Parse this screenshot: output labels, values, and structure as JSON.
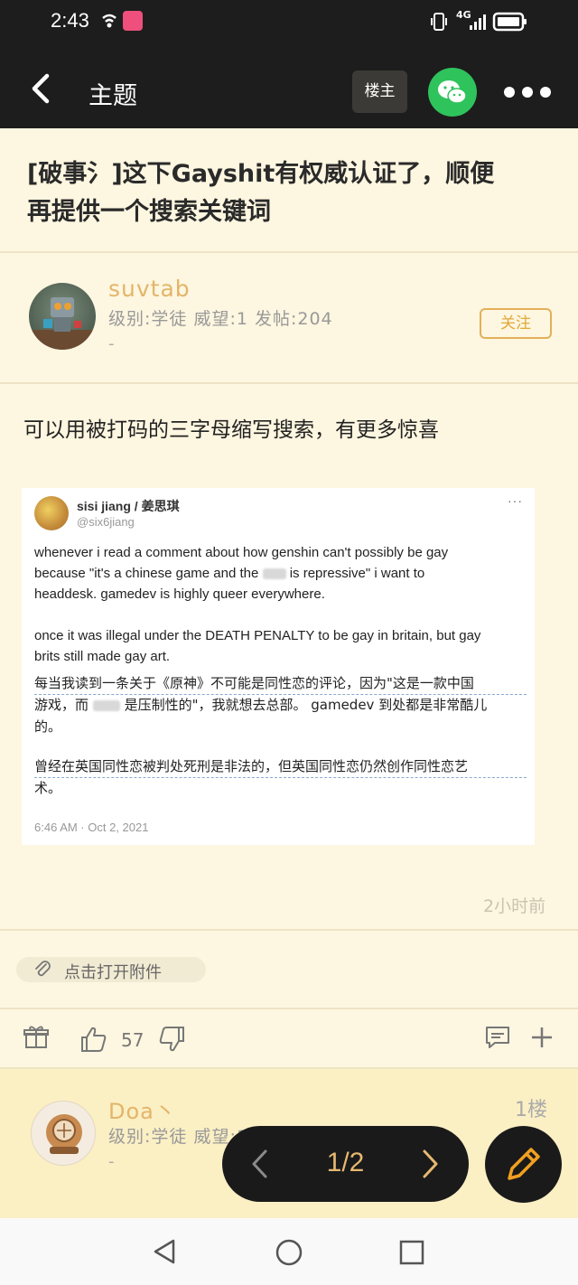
{
  "status_bar": {
    "time": "2:43",
    "network_badge": "4G"
  },
  "app_bar": {
    "title": "主题",
    "op_label": "楼主"
  },
  "post": {
    "title_line1": "[破事氵]这下Gayshit有权威认证了，顺便",
    "title_line2": "再提供一个搜索关键词",
    "author": {
      "name": "suvtab",
      "info": "级别:学徒 威望:1 发帖:204",
      "signature": "-"
    },
    "follow_label": "关注",
    "body": "可以用被打码的三字母缩写搜索，有更多惊喜",
    "time_ago": "2小时前",
    "attachment_label": "点击打开附件",
    "like_count": "57"
  },
  "tweet": {
    "name": "sisi jiang / 姜思琪",
    "handle": "@six6jiang",
    "more": "···",
    "en_line1": "whenever i read a comment about how genshin can't possibly be gay",
    "en_line2a": "because \"it's a chinese game and the",
    "en_line2b": "is repressive\" i want to",
    "en_line3": "headdesk. gamedev is highly queer everywhere.",
    "en_line4": "once it was illegal under the DEATH PENALTY to be gay in britain, but gay",
    "en_line5": "brits still made gay art.",
    "cn_line1": "每当我读到一条关于《原神》不可能是同性恋的评论，因为\"这是一款中国",
    "cn_line2a": "游戏，而",
    "cn_line2b": "是压制性的\"，我就想去总部。 gamedev 到处都是非常酷儿",
    "cn_line3": "的。",
    "cn_line4": "曾经在英国同性恋被判处死刑是非法的，但英国同性恋仍然创作同性恋艺",
    "cn_line5": "术。",
    "timestamp": "6:46 AM · Oct 2, 2021"
  },
  "reply": {
    "name": "Doa丶",
    "floor": "1楼",
    "info": "级别:学徒 威望:1 发帖:11",
    "signature": "-"
  },
  "pager": {
    "label": "1/2"
  },
  "colors": {
    "background": "#fdf6e0",
    "accent": "#e3b56a",
    "dark": "#1d1d1d",
    "wechat": "#2fc35c",
    "reply_bg": "#fbefc4"
  }
}
